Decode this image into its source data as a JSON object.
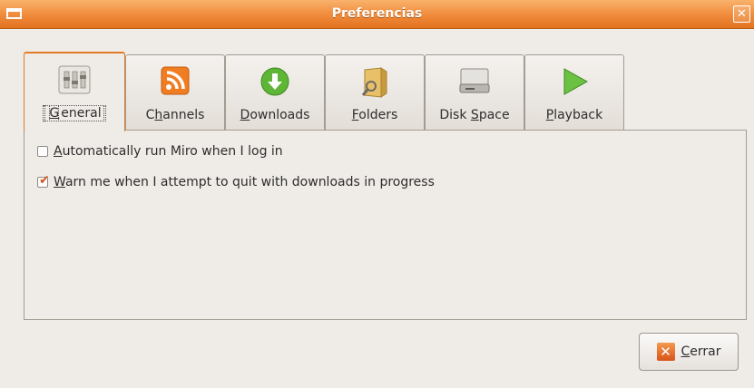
{
  "window": {
    "title": "Preferencias",
    "close_glyph": "✕",
    "menu_icon": "window-menu-icon"
  },
  "tabs": [
    {
      "label_pre": "",
      "mnemonic": "G",
      "label_post": "eneral",
      "icon": "general-settings-icon",
      "active": true
    },
    {
      "label_pre": "C",
      "mnemonic": "h",
      "label_post": "annels",
      "icon": "rss-feed-icon",
      "active": false
    },
    {
      "label_pre": "",
      "mnemonic": "D",
      "label_post": "ownloads",
      "icon": "download-arrow-icon",
      "active": false
    },
    {
      "label_pre": "",
      "mnemonic": "F",
      "label_post": "olders",
      "icon": "folder-icon",
      "active": false
    },
    {
      "label_pre": "Disk ",
      "mnemonic": "S",
      "label_post": "pace",
      "icon": "hard-disk-icon",
      "active": false
    },
    {
      "label_pre": "",
      "mnemonic": "P",
      "label_post": "layback",
      "icon": "play-icon",
      "active": false
    }
  ],
  "general": {
    "auto_run": {
      "mnemonic": "A",
      "rest": "utomatically run Miro when I log in",
      "checked": false
    },
    "warn_quit": {
      "mnemonic": "W",
      "rest": "arn me when I attempt to quit with downloads in progress",
      "checked": true
    }
  },
  "footer": {
    "close_button": {
      "mnemonic": "C",
      "rest": "errar",
      "icon": "close-x-icon",
      "icon_glyph": "✕"
    }
  },
  "colors": {
    "titlebar": "#f08a3a",
    "background": "#efebe7",
    "accent": "#e27a26"
  }
}
